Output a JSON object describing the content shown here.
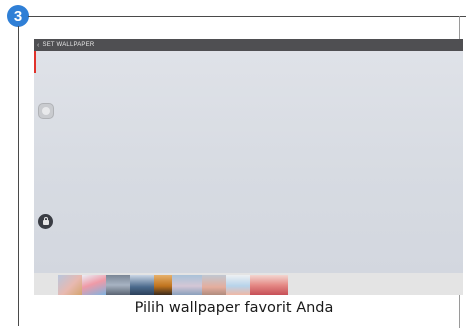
{
  "step": {
    "number": "3"
  },
  "screen": {
    "title": "SET WALLPAPER",
    "back_icon": "chevron-left-icon",
    "buttons": {
      "home_icon": "home-circle-icon",
      "lock_icon": "lock-icon"
    },
    "thumbnails": [
      "thumbnail-1",
      "thumbnail-2",
      "thumbnail-3",
      "thumbnail-4",
      "thumbnail-5",
      "thumbnail-6",
      "thumbnail-7",
      "thumbnail-8",
      "thumbnail-9"
    ]
  },
  "caption": "Pilih wallpaper favorit Anda",
  "colors": {
    "badge": "#2f7fd6",
    "titlebar": "#4f4f52",
    "accent_red": "#e0322b",
    "screen_bg": "#d8dce3"
  }
}
